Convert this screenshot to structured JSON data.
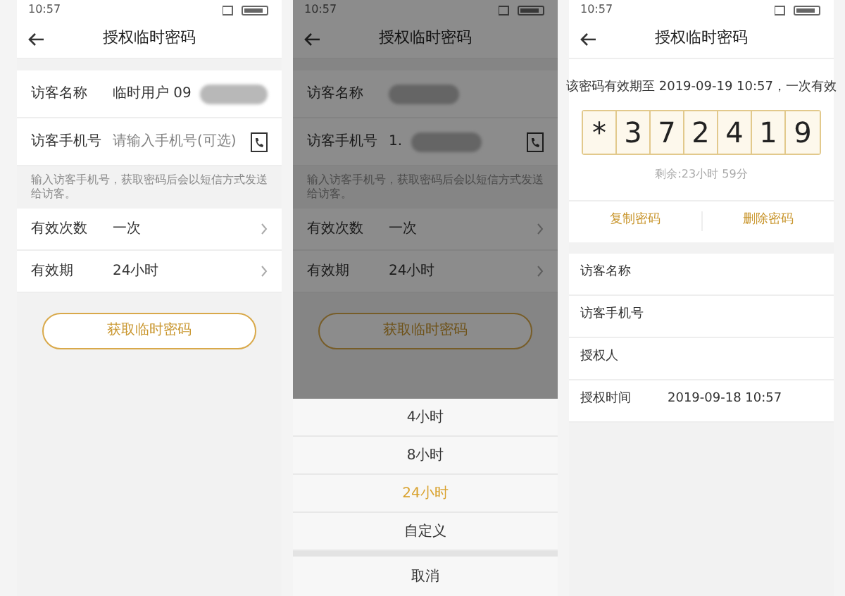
{
  "screens": [
    {
      "kind": "form",
      "status_time": "10:57",
      "title": "授权临时密码",
      "fields": [
        {
          "label": "访客名称",
          "value": "临时用户 09",
          "redacted": true
        },
        {
          "label": "访客手机号",
          "placeholder": "请输入手机号(可选)",
          "redacted": false
        }
      ],
      "hint": "输入访客手机号，获取密码后会以短信方式发送给访客。",
      "options": [
        {
          "label": "有效次数",
          "value": "一次"
        },
        {
          "label": "有效期",
          "value": "24小时"
        }
      ],
      "button": "获取临时密码"
    },
    {
      "kind": "form",
      "status_time": "10:57",
      "title": "授权临时密码",
      "fields": [
        {
          "label": "访客名称",
          "redacted": true
        },
        {
          "label": "访客手机号",
          "value": "1.",
          "redacted": true
        }
      ],
      "hint": "输入访客手机号，获取密码后会以短信方式发送给访客。",
      "options": [
        {
          "label": "有效次数",
          "value": "一次"
        },
        {
          "label": "有效期",
          "value": "24小时"
        }
      ],
      "button": "获取临时密码",
      "sheet": {
        "items": [
          {
            "label": "4小时",
            "selected": false
          },
          {
            "label": "8小时",
            "selected": false
          },
          {
            "label": "24小时",
            "selected": true
          },
          {
            "label": "自定义",
            "selected": false
          }
        ],
        "cancel": "取消"
      }
    },
    {
      "kind": "result",
      "status_time": "10:57",
      "title": "授权临时密码",
      "validity": "该密码有效期至 2019-09-19 10:57，一次有效",
      "digits": [
        "*",
        "3",
        "7",
        "2",
        "4",
        "1",
        "9"
      ],
      "remaining": "剩余:23小时 59分",
      "actions": [
        "复制密码",
        "删除密码"
      ],
      "info": [
        {
          "label": "访客名称"
        },
        {
          "label": "访客手机号"
        },
        {
          "label": "授权人"
        },
        {
          "label": "授权时间",
          "value": "2019-09-18 10:57"
        }
      ]
    }
  ]
}
